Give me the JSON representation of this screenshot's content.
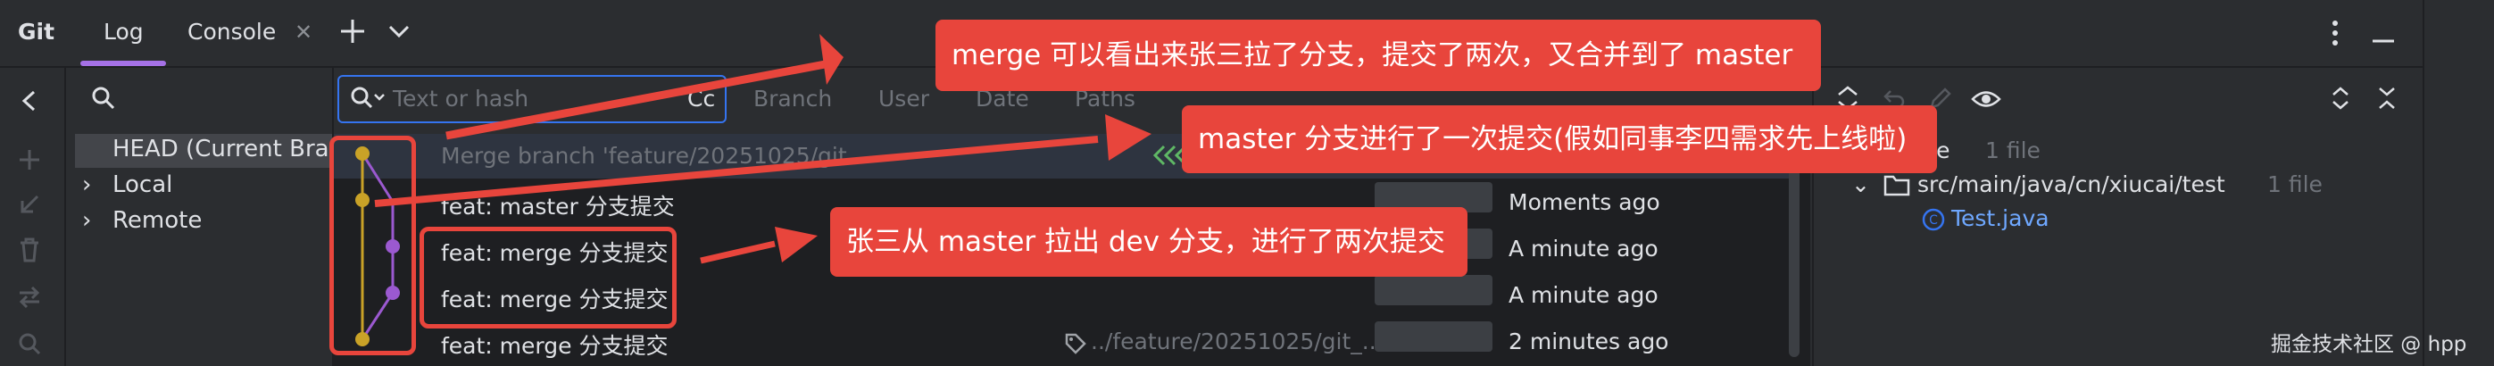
{
  "topbar": {
    "app_label": "Git",
    "tabs": [
      {
        "label": "Log"
      },
      {
        "label": "Console"
      }
    ]
  },
  "branches": {
    "head": "HEAD (Current Bran",
    "local": "Local",
    "remote": "Remote"
  },
  "filter": {
    "search_placeholder": "Text or hash",
    "cc_label": "Cc",
    "branch_label": "Branch",
    "user_label": "User",
    "date_label": "Date",
    "paths_label": "Paths"
  },
  "commits": [
    {
      "message": "Merge branch 'feature/20251025/git...",
      "time": ""
    },
    {
      "message": "feat: master 分支提交",
      "time": "Moments ago"
    },
    {
      "message": "feat: merge 分支提交",
      "time": "A minute ago"
    },
    {
      "message": "feat: merge 分支提交",
      "time": "A minute ago"
    },
    {
      "message": "feat: merge 分支提交",
      "time": "2 minutes ago",
      "ref": "../feature/20251025/git_..."
    }
  ],
  "changes": {
    "root": "ai-exercise",
    "root_count": "1 file",
    "folder": "src/main/java/cn/xiucai/test",
    "folder_count": "1 file",
    "file": "Test.java"
  },
  "annotations": {
    "callout_merge": "merge 可以看出来张三拉了分支，提交了两次，又合并到了 master",
    "callout_master": "master 分支进行了一次提交(假如同事李四需求先上线啦)",
    "callout_dev": "张三从 master 拉出 dev 分支，进行了两次提交"
  },
  "watermark": "掘金技术社区 @ hpp",
  "colors": {
    "accent": "#a571e6",
    "callout": "#e8453c",
    "graph_master": "#c9a227",
    "graph_dev": "#9b59d0",
    "focus": "#3574f0"
  }
}
